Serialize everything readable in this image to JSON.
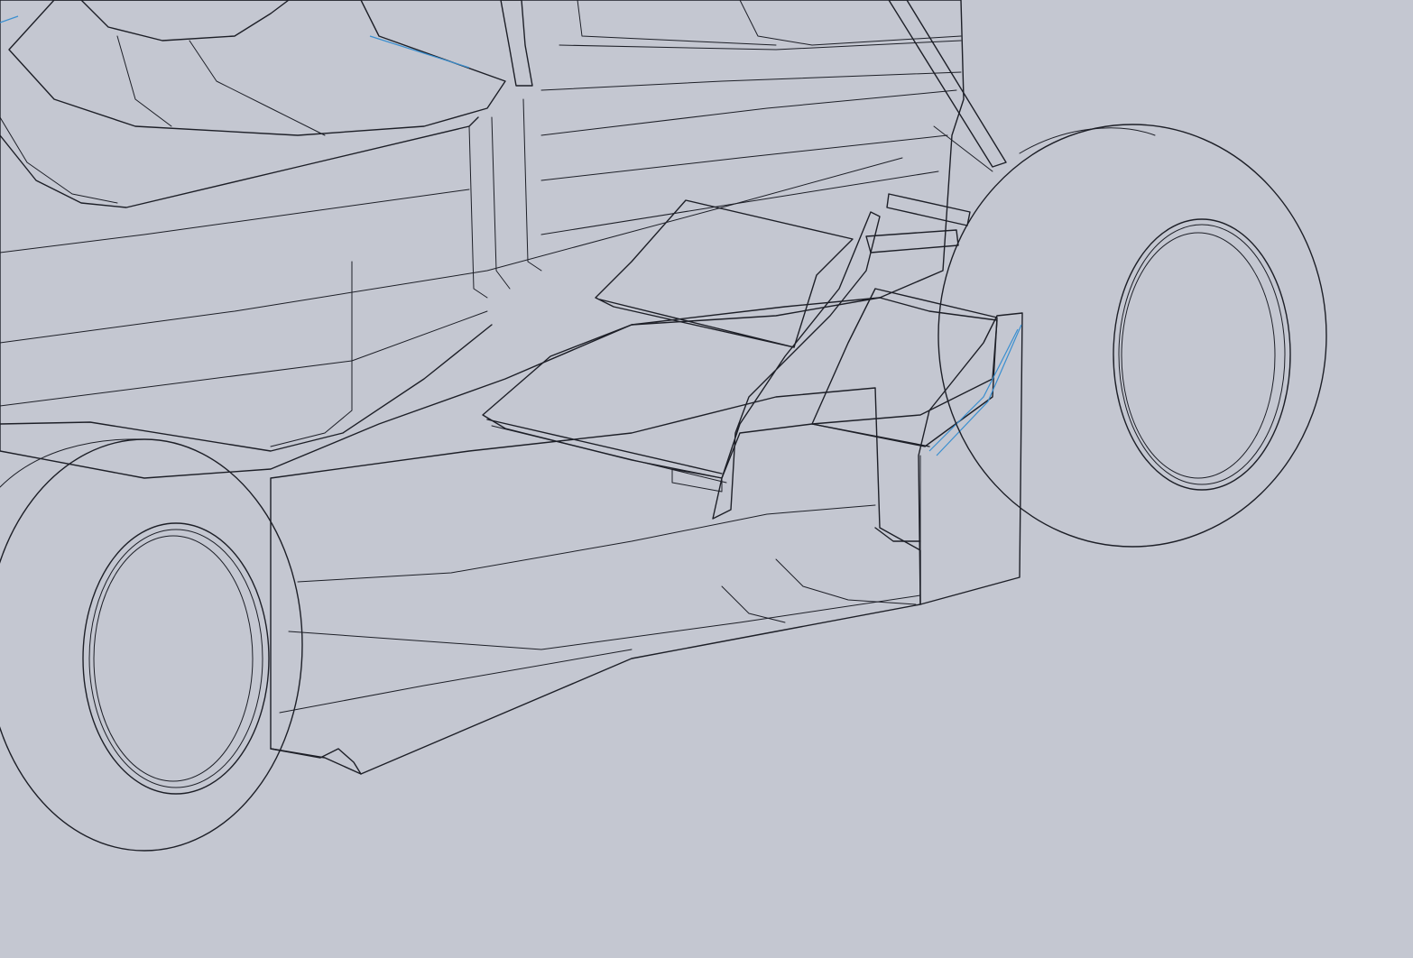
{
  "scene": {
    "background_color": "#c4c7d1",
    "body_color": "#4c4f5c",
    "body_light_color": "#6b6e7c",
    "edge_color": "#1d1f27",
    "highlight_color": "#3a8fd0"
  },
  "model": {
    "parts": [
      {
        "name": "chassis-body",
        "icon": "car-body-icon"
      },
      {
        "name": "cockpit",
        "icon": "cockpit-icon"
      },
      {
        "name": "roll-bar",
        "icon": "roll-bar-icon"
      },
      {
        "name": "nose-cone",
        "icon": "nose-icon"
      },
      {
        "name": "front-wing-upper-flap",
        "icon": "wing-icon"
      },
      {
        "name": "front-wing-lower-flap",
        "icon": "wing-icon"
      },
      {
        "name": "front-wing-endplate",
        "icon": "endplate-icon"
      },
      {
        "name": "front-left-tire",
        "icon": "tire-icon"
      },
      {
        "name": "front-right-tire",
        "icon": "tire-icon"
      },
      {
        "name": "suspension-arms",
        "icon": "suspension-icon"
      }
    ]
  }
}
